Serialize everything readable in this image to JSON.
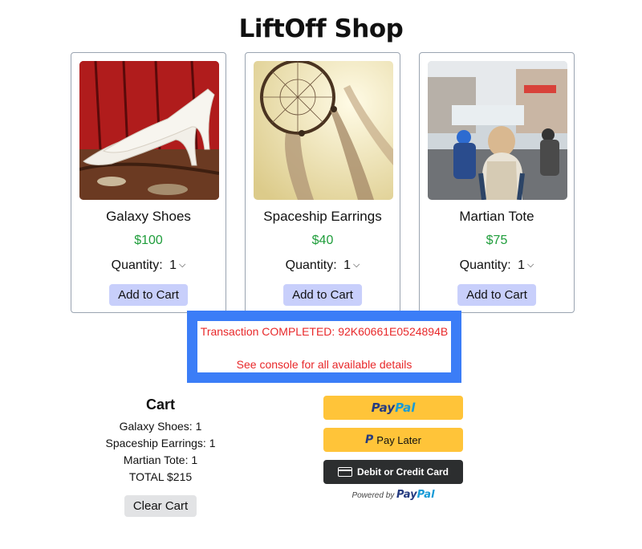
{
  "title": "LiftOff Shop",
  "products": [
    {
      "name": "Galaxy Shoes",
      "price": "$100",
      "quantity_label": "Quantity:",
      "quantity_value": "1",
      "add_label": "Add to Cart"
    },
    {
      "name": "Spaceship Earrings",
      "price": "$40",
      "quantity_label": "Quantity:",
      "quantity_value": "1",
      "add_label": "Add to Cart"
    },
    {
      "name": "Martian Tote",
      "price": "$75",
      "quantity_label": "Quantity:",
      "quantity_value": "1",
      "add_label": "Add to Cart"
    }
  ],
  "notice": {
    "line1": "Transaction COMPLETED: 92K60661E0524894B",
    "line2": "See console for all available details"
  },
  "cart": {
    "title": "Cart",
    "lines": [
      "Galaxy Shoes: 1",
      "Spaceship Earrings: 1",
      "Martian Tote: 1"
    ],
    "total": "TOTAL $215",
    "clear_label": "Clear Cart"
  },
  "payment": {
    "paypal_pay": "Pay",
    "paypal_pal": "Pal",
    "pay_later_label": "Pay Later",
    "card_label": "Debit or Credit Card",
    "powered_by": "Powered by"
  },
  "colors": {
    "price": "#1f9d3b",
    "notice_border": "#3b7df7",
    "notice_text": "#e8282a",
    "add_button": "#c8cffb",
    "paypal_yellow": "#ffc439",
    "card_button": "#2c2e2f"
  },
  "icons": [
    "chevron-down-icon",
    "paypal-p-icon",
    "credit-card-icon"
  ]
}
